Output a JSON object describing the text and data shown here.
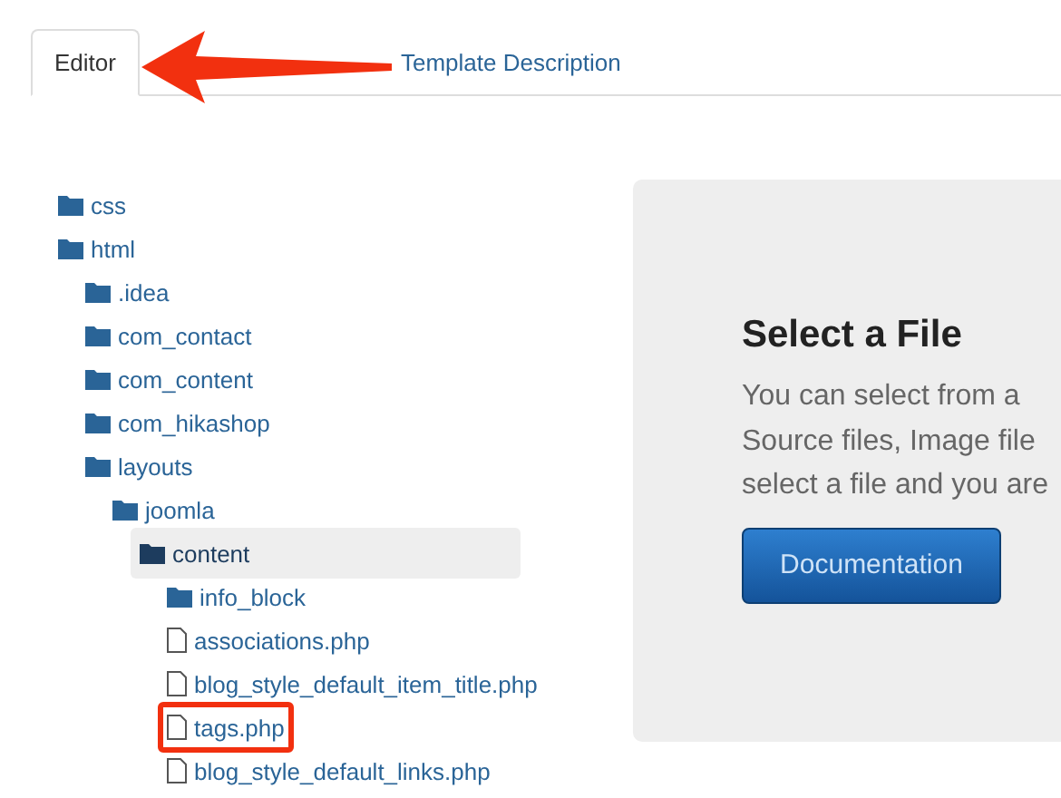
{
  "tabs": [
    {
      "label": "Editor",
      "selected": true
    },
    {
      "label": "Template Description",
      "selected": false
    }
  ],
  "tree": [
    {
      "kind": "folder",
      "name": "css",
      "selected": false,
      "highlighted": false
    },
    {
      "kind": "folder",
      "name": "html",
      "selected": false,
      "highlighted": false,
      "children": [
        {
          "kind": "folder",
          "name": ".idea",
          "selected": false,
          "highlighted": false
        },
        {
          "kind": "folder",
          "name": "com_contact",
          "selected": false,
          "highlighted": false
        },
        {
          "kind": "folder",
          "name": "com_content",
          "selected": false,
          "highlighted": false
        },
        {
          "kind": "folder",
          "name": "com_hikashop",
          "selected": false,
          "highlighted": false
        },
        {
          "kind": "folder",
          "name": "layouts",
          "selected": false,
          "highlighted": false,
          "children": [
            {
              "kind": "folder",
              "name": "joomla",
              "selected": false,
              "highlighted": false,
              "children": [
                {
                  "kind": "folder",
                  "name": "content",
                  "selected": true,
                  "highlighted": false,
                  "children": [
                    {
                      "kind": "folder",
                      "name": "info_block",
                      "selected": false,
                      "highlighted": false
                    },
                    {
                      "kind": "file",
                      "name": "associations.php",
                      "selected": false,
                      "highlighted": false
                    },
                    {
                      "kind": "file",
                      "name": "blog_style_default_item_title.php",
                      "selected": false,
                      "highlighted": false
                    },
                    {
                      "kind": "file",
                      "name": "tags.php",
                      "selected": false,
                      "highlighted": true
                    },
                    {
                      "kind": "file",
                      "name": "blog_style_default_links.php",
                      "selected": false,
                      "highlighted": false
                    }
                  ]
                }
              ]
            }
          ]
        }
      ]
    }
  ],
  "panel": {
    "title": "Select a File",
    "lines": [
      "You can select from a",
      "Source files, Image file",
      "select a file and you are"
    ],
    "button": "Documentation"
  }
}
